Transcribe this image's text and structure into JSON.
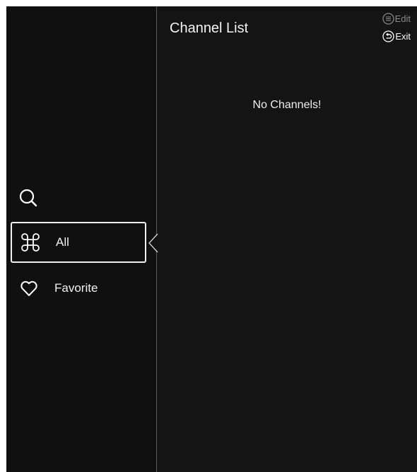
{
  "header": {
    "title": "Channel List"
  },
  "hints": {
    "edit_label": "Edit",
    "edit_icon": "menu-lines-icon",
    "exit_label": "Exit",
    "exit_icon": "return-arrow-icon"
  },
  "sidebar": {
    "search_icon": "search-icon",
    "items": [
      {
        "label": "All",
        "icon": "command-cloverleaf-icon",
        "selected": true
      },
      {
        "label": "Favorite",
        "icon": "heart-icon",
        "selected": false
      }
    ]
  },
  "main": {
    "empty_message": "No Channels!"
  },
  "colors": {
    "background": "#141414",
    "sidebar": "#101010",
    "text": "#ffffff",
    "muted": "#8a8a8a",
    "divider": "#5a5a5a",
    "selection_border": "#f0f0f0"
  }
}
